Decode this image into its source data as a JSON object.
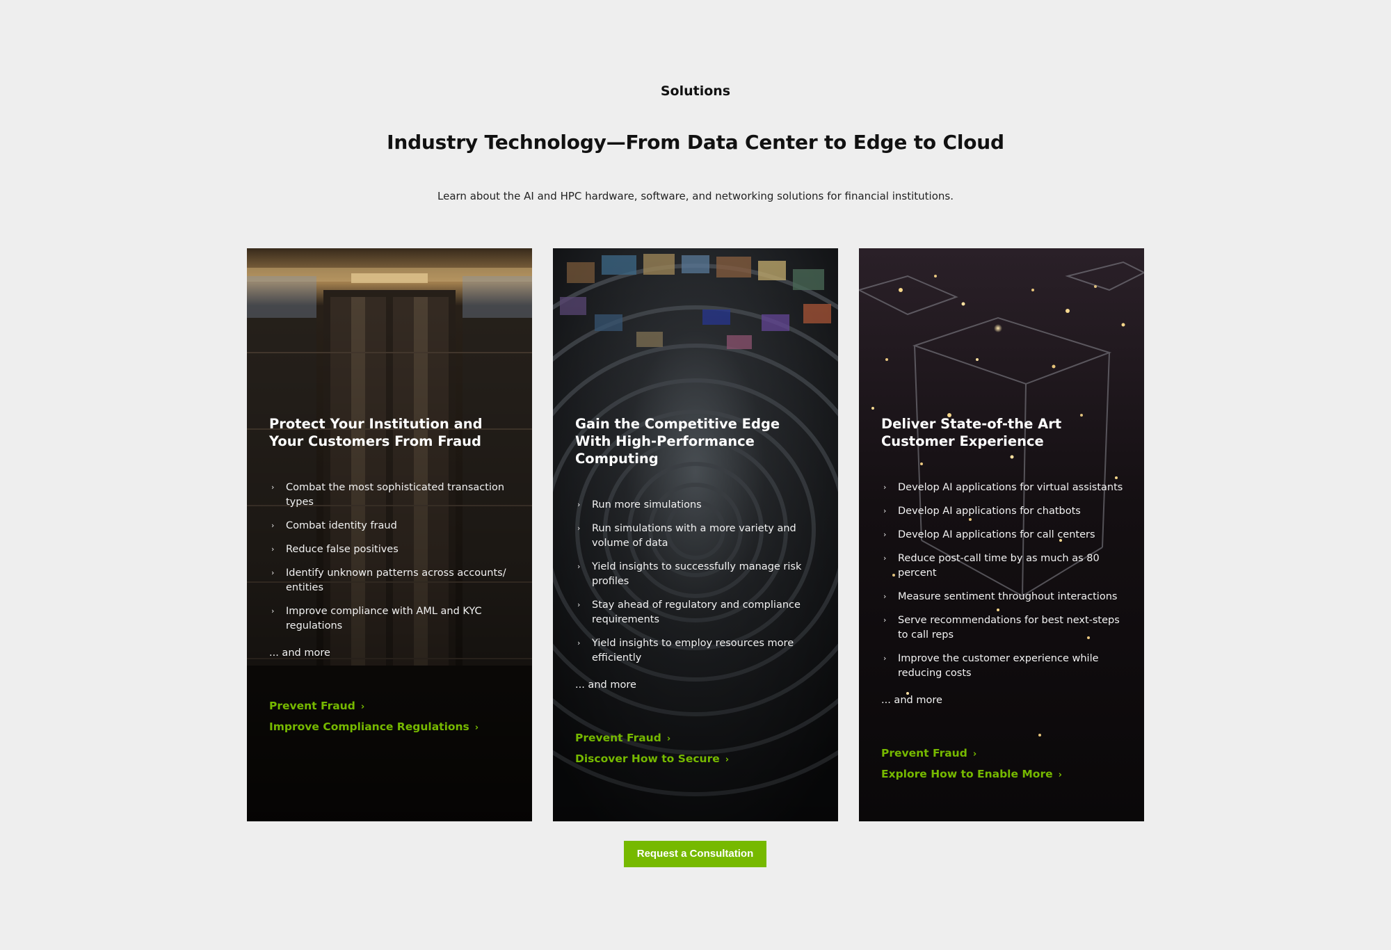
{
  "header": {
    "eyebrow": "Solutions",
    "title": "Industry Technology—From Data Center to Edge to Cloud",
    "subtitle": "Learn about the AI and HPC hardware, software, and networking solutions for financial institutions."
  },
  "cards": [
    {
      "title": "Protect Your Institution and Your Customers From Fraud",
      "bullets": [
        "Combat the most sophisticated transaction types",
        "Combat identity fraud",
        "Reduce false positives",
        "Identify unknown patterns across accounts/ entities",
        "Improve compliance with AML and KYC regulations"
      ],
      "more": "... and more",
      "links": [
        "Prevent Fraud",
        "Improve Compliance Regulations"
      ]
    },
    {
      "title": "Gain the Competitive Edge With High-Performance Computing",
      "bullets": [
        "Run more simulations",
        "Run simulations with a more variety and volume of data",
        "Yield insights to successfully manage risk profiles",
        "Stay ahead of regulatory and compliance requirements",
        "Yield insights to employ resources more efficiently"
      ],
      "more": "... and more",
      "links": [
        "Prevent Fraud",
        "Discover How to Secure"
      ]
    },
    {
      "title": "Deliver State-of-the Art Customer Experience",
      "bullets": [
        "Develop AI applications for virtual assistants",
        "Develop AI applications for chatbots",
        "Develop AI applications for call centers",
        "Reduce post-call time by as much as 80 percent",
        "Measure sentiment throughout interactions",
        "Serve recommendations for best next-steps to call reps",
        "Improve the customer experience while reducing costs"
      ],
      "more": "... and more",
      "links": [
        "Prevent Fraud",
        "Explore How to Enable More"
      ]
    }
  ],
  "cta": {
    "label": "Request a Consultation"
  },
  "colors": {
    "accent": "#76b900",
    "page_bg": "#eeeeee"
  },
  "icons": {
    "bullet": "chevron-right-icon",
    "link_arrow": "chevron-right-icon"
  }
}
